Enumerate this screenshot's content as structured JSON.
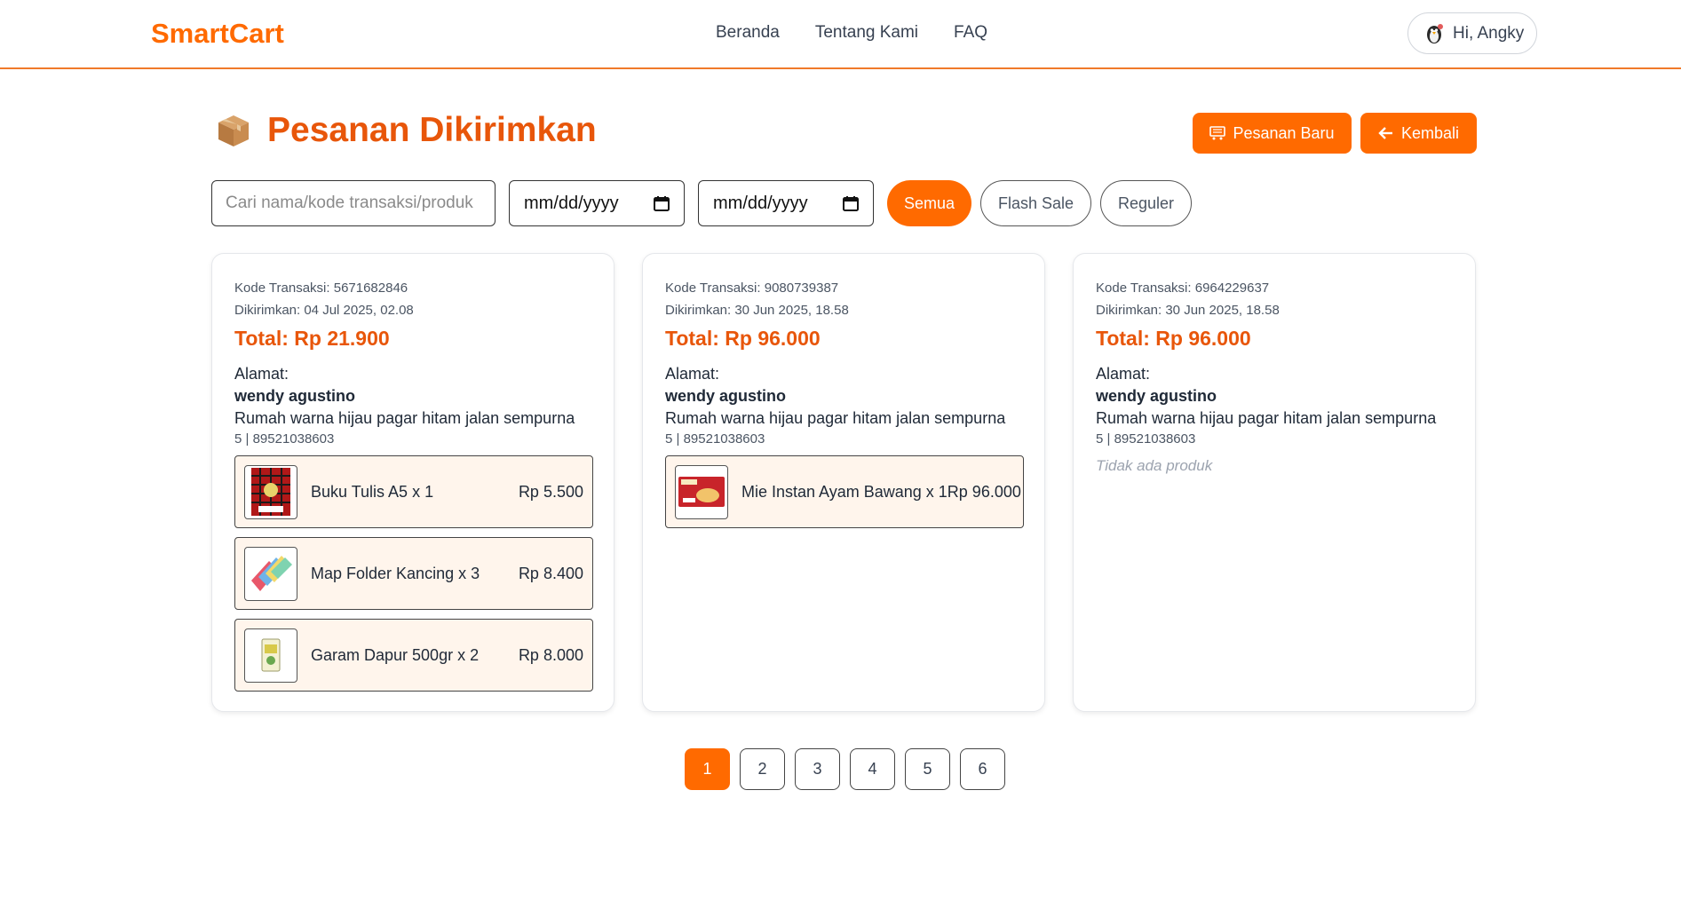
{
  "header": {
    "brand": "SmartCart",
    "nav": [
      "Beranda",
      "Tentang Kami",
      "FAQ"
    ],
    "user_greeting": "Hi, Angky"
  },
  "page": {
    "title": "Pesanan Dikirimkan",
    "new_order_label": "Pesanan Baru",
    "back_label": "Kembali"
  },
  "filters": {
    "search_placeholder": "Cari nama/kode transaksi/produk",
    "date_from": "mm/dd/yyyy",
    "date_to": "mm/dd/yyyy",
    "chips": [
      "Semua",
      "Flash Sale",
      "Reguler"
    ],
    "active_chip": "Semua"
  },
  "orders": [
    {
      "code": "Kode Transaksi: 5671682846",
      "shipped": "Dikirimkan: 04 Jul 2025, 02.08",
      "total": "Total: Rp 21.900",
      "address_label": "Alamat:",
      "name": "wendy agustino",
      "address": "Rumah warna hijau pagar hitam jalan sempurna",
      "phone": "5 | 89521038603",
      "items": [
        {
          "name": "Buku Tulis A5 x 1",
          "price": "Rp 5.500",
          "thumb": "notebook"
        },
        {
          "name": "Map Folder Kancing x 3",
          "price": "Rp 8.400",
          "thumb": "folder"
        },
        {
          "name": "Garam Dapur 500gr x 2",
          "price": "Rp 8.000",
          "thumb": "salt"
        }
      ]
    },
    {
      "code": "Kode Transaksi: 9080739387",
      "shipped": "Dikirimkan: 30 Jun 2025, 18.58",
      "total": "Total: Rp 96.000",
      "address_label": "Alamat:",
      "name": "wendy agustino",
      "address": "Rumah warna hijau pagar hitam jalan sempurna",
      "phone": "5 | 89521038603",
      "items": [
        {
          "name": "Mie Instan Ayam Bawang x 1",
          "price": "Rp 96.000",
          "thumb": "noodle"
        }
      ]
    },
    {
      "code": "Kode Transaksi: 6964229637",
      "shipped": "Dikirimkan: 30 Jun 2025, 18.58",
      "total": "Total: Rp 96.000",
      "address_label": "Alamat:",
      "name": "wendy agustino",
      "address": "Rumah warna hijau pagar hitam jalan sempurna",
      "phone": "5 | 89521038603",
      "no_product": "Tidak ada produk"
    }
  ],
  "pagination": {
    "pages": [
      "1",
      "2",
      "3",
      "4",
      "5",
      "6"
    ],
    "current": "1"
  }
}
